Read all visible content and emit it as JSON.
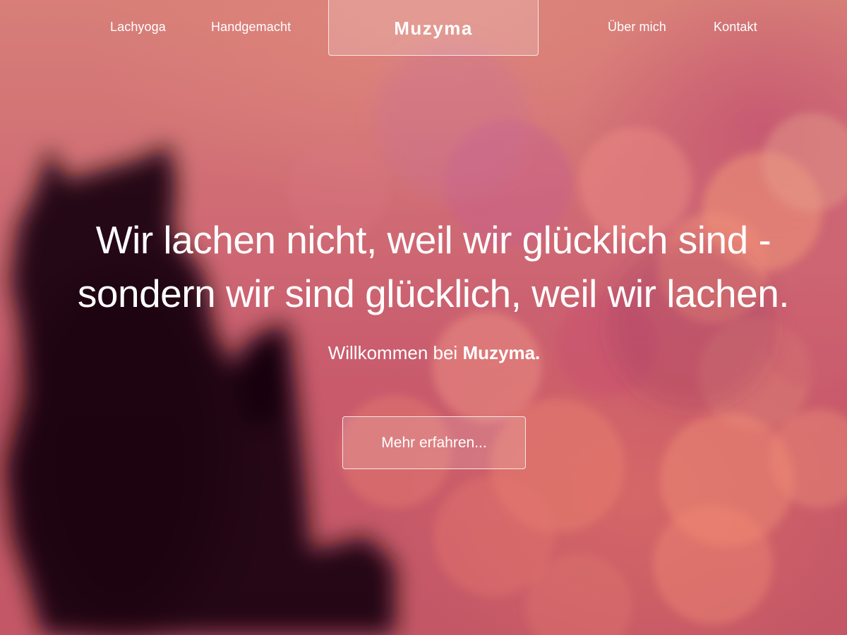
{
  "nav": {
    "items": [
      {
        "label": "Lachyoga"
      },
      {
        "label": "Handgemacht"
      },
      {
        "label": "Über mich"
      },
      {
        "label": "Kontakt"
      }
    ],
    "brand": "Muzyma"
  },
  "hero": {
    "headline_line1": "Wir lachen nicht, weil wir glücklich sind -",
    "headline_line2": "sondern wir sind glücklich, weil wir lachen.",
    "welcome_prefix": "Willkommen bei",
    "welcome_brand": "Muzyma.",
    "cta_label": "Mehr erfahren..."
  },
  "colors": {
    "background_top": "#d77f78",
    "background_bottom": "#c45766",
    "text": "#ffffff"
  }
}
